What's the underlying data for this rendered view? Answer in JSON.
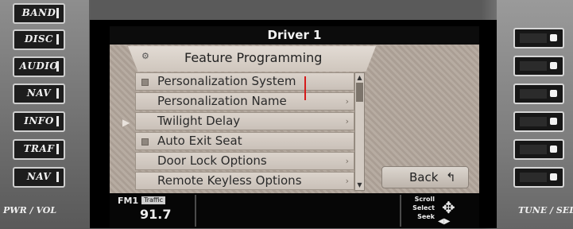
{
  "left_buttons": [
    "BAND",
    "DISC",
    "AUDIO",
    "NAV",
    "INFO",
    "TRAF",
    "NAV"
  ],
  "left_knob_label": "PWR / VOL",
  "right_knob_label": "TUNE / SEL",
  "screen": {
    "title": "Driver 1",
    "header": "Feature Programming",
    "menu_items": [
      {
        "label": "Personalization System",
        "checked": true,
        "has_arrow": false
      },
      {
        "label": "Personalization Name",
        "checked": false,
        "has_arrow": true
      },
      {
        "label": "Twilight Delay",
        "checked": false,
        "has_arrow": true
      },
      {
        "label": "Auto Exit Seat",
        "checked": true,
        "has_arrow": false
      },
      {
        "label": "Door Lock Options",
        "checked": false,
        "has_arrow": true
      },
      {
        "label": "Remote Keyless Options",
        "checked": false,
        "has_arrow": true
      }
    ],
    "back_label": "Back",
    "icons": {
      "header": "settings-icon",
      "back": "return-icon",
      "selection": "pointer-icon"
    }
  },
  "status_bar": {
    "band": "FM1",
    "traffic": "Traffic",
    "frequency": "91.7",
    "scroll": "Scroll",
    "select": "Select",
    "seek": "Seek"
  }
}
